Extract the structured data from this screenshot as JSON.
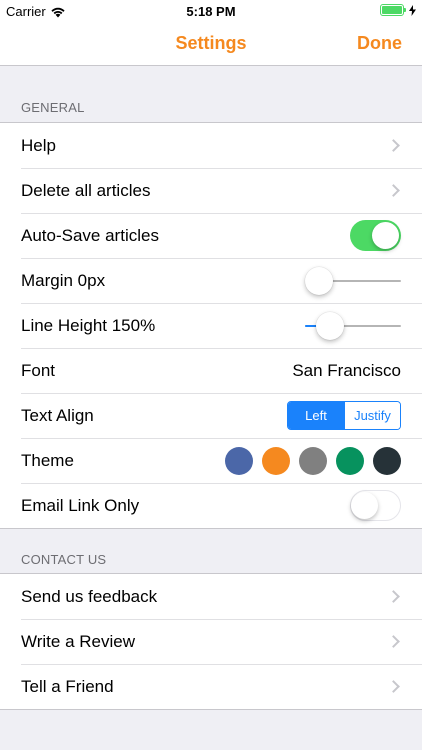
{
  "status_bar": {
    "carrier": "Carrier",
    "time": "5:18 PM",
    "battery_color": "#4cd964"
  },
  "nav": {
    "title": "Settings",
    "done_label": "Done",
    "accent_color": "#f5891f"
  },
  "general": {
    "header": "GENERAL",
    "help_label": "Help",
    "delete_label": "Delete all articles",
    "autosave_label": "Auto-Save articles",
    "autosave_on": true,
    "margin_label": "Margin 0px",
    "margin_value": 0,
    "line_height_label": "Line Height 150%",
    "line_height_value": 0.16,
    "font_label": "Font",
    "font_value": "San Francisco",
    "text_align_label": "Text Align",
    "text_align_options": [
      "Left",
      "Justify"
    ],
    "text_align_selected": "Left",
    "theme_label": "Theme",
    "theme_colors": [
      "#4b67a8",
      "#f5891f",
      "#808080",
      "#07925e",
      "#263238"
    ],
    "email_link_label": "Email Link Only",
    "email_link_on": false
  },
  "contact": {
    "header": "CONTACT US",
    "feedback_label": "Send us feedback",
    "review_label": "Write a Review",
    "friend_label": "Tell a Friend"
  }
}
